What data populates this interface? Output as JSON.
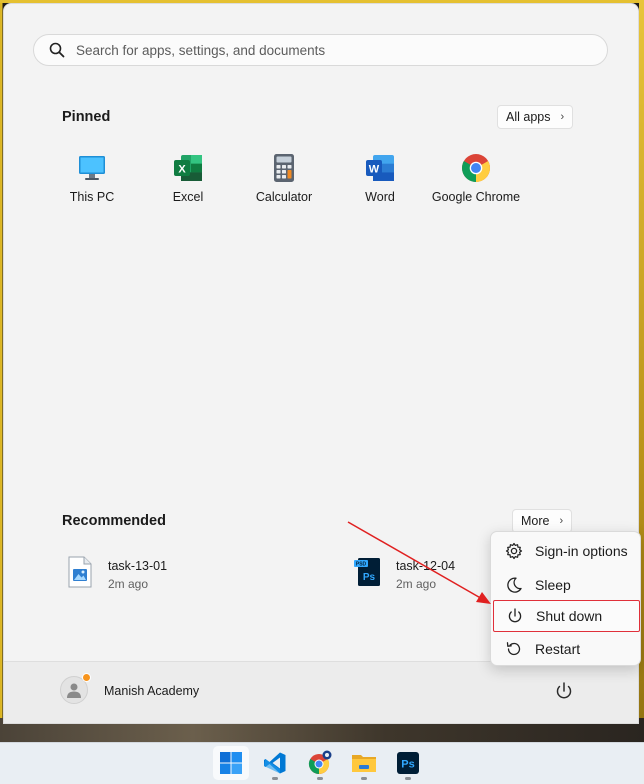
{
  "search": {
    "placeholder": "Search for apps, settings, and documents"
  },
  "pinned": {
    "title": "Pinned",
    "all_apps_label": "All apps",
    "apps": [
      {
        "label": "This PC",
        "icon": "this-pc-icon"
      },
      {
        "label": "Excel",
        "icon": "excel-icon"
      },
      {
        "label": "Calculator",
        "icon": "calculator-icon"
      },
      {
        "label": "Word",
        "icon": "word-icon"
      },
      {
        "label": "Google Chrome",
        "icon": "chrome-icon"
      }
    ]
  },
  "recommended": {
    "title": "Recommended",
    "more_label": "More",
    "items": [
      {
        "name": "task-13-01",
        "time": "2m ago",
        "icon": "image-file-icon"
      },
      {
        "name": "task-12-04",
        "time": "2m ago",
        "icon": "photoshop-file-icon"
      }
    ]
  },
  "user": {
    "name": "Manish Academy"
  },
  "power_menu": {
    "items": [
      {
        "label": "Sign-in options",
        "icon": "gear-icon"
      },
      {
        "label": "Sleep",
        "icon": "moon-icon"
      },
      {
        "label": "Shut down",
        "icon": "power-icon",
        "highlighted": true
      },
      {
        "label": "Restart",
        "icon": "restart-icon"
      }
    ]
  },
  "colors": {
    "accent": "#0067c0",
    "highlight_border": "#e0303a",
    "annotation_arrow": "#e02020"
  },
  "taskbar": {
    "items": [
      {
        "icon": "windows-start-icon"
      },
      {
        "icon": "vscode-icon"
      },
      {
        "icon": "chrome-canary-icon"
      },
      {
        "icon": "file-explorer-icon"
      },
      {
        "icon": "photoshop-icon"
      }
    ]
  }
}
